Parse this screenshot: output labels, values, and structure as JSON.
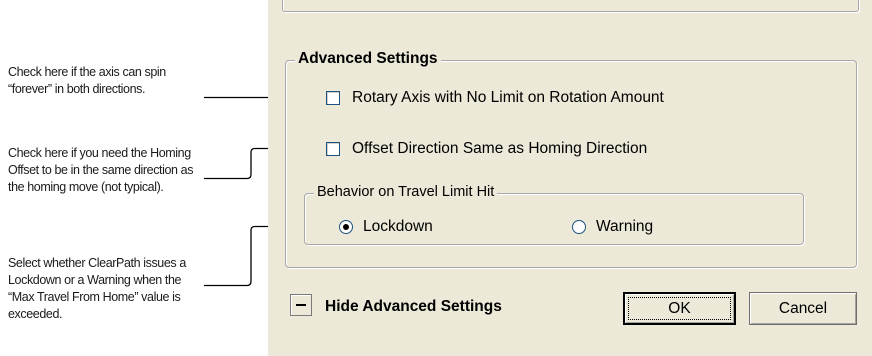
{
  "annotations": {
    "rotary_note": "Check here if the axis can spin “forever” in both directions.",
    "offset_note": "Check here if you need the Homing Offset to be in the same direction as the homing move (not typical).",
    "limit_note": "Select whether ClearPath issues a Lockdown or a Warning when the “Max Travel From Home” value is exceeded."
  },
  "dialog": {
    "advanced_settings": {
      "title": "Advanced Settings",
      "rotary_checkbox": {
        "label": "Rotary Axis with No Limit on Rotation Amount",
        "checked": false
      },
      "offset_checkbox": {
        "label": "Offset Direction Same as Homing Direction",
        "checked": false
      },
      "travel_limit_group": {
        "title": "Behavior on Travel Limit Hit",
        "options": [
          {
            "label": "Lockdown",
            "selected": true
          },
          {
            "label": "Warning",
            "selected": false
          }
        ]
      }
    },
    "footer": {
      "toggle_icon": "minus-icon",
      "toggle_label": "Hide Advanced Settings",
      "ok_label": "OK",
      "cancel_label": "Cancel"
    }
  },
  "colors": {
    "dialog_background": "#ece9d8",
    "groupbox_border": "#a7a6aa",
    "control_border": "#1c5180",
    "callout_line": "#000000"
  }
}
